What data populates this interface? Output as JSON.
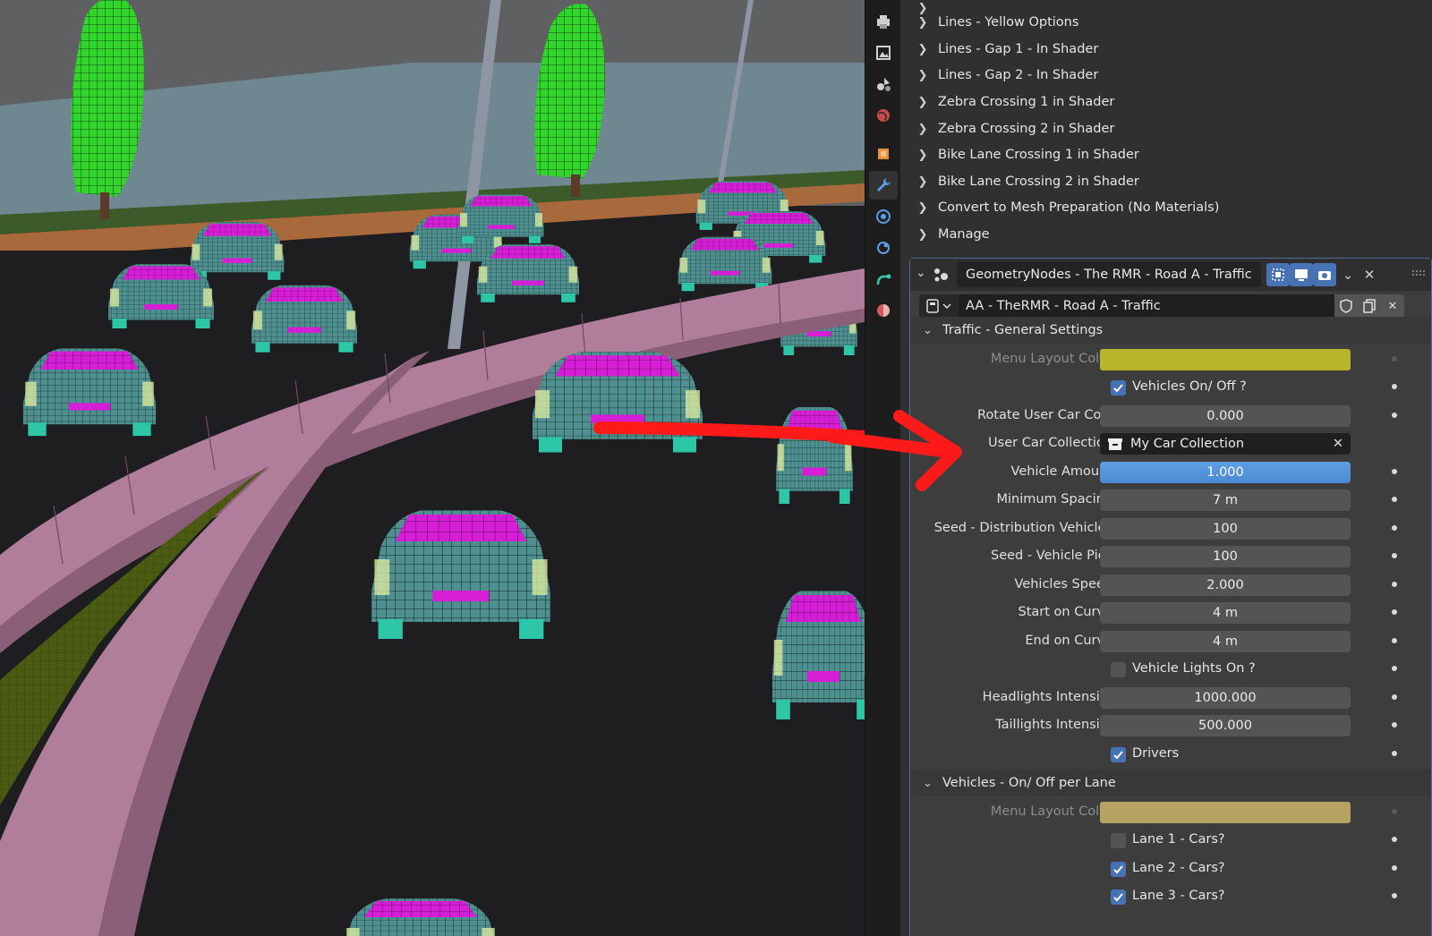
{
  "panel": {
    "collapsed_subpanels": [
      "Lines - Yellow Options",
      "Lines - Gap 1 - In Shader",
      "Lines - Gap 2 - In Shader",
      "Zebra Crossing 1 in Shader",
      "Zebra Crossing 2 in Shader",
      "Bike Lane Crossing 1 in Shader",
      "Bike Lane Crossing 2 in Shader",
      "Convert to Mesh Preparation (No Materials)",
      "Manage"
    ],
    "modifier": {
      "name": "GeometryNodes - The RMR - Road A - Traffic",
      "node_group": "AA - TheRMR - Road A - Traffic"
    },
    "section_general": {
      "title": "Traffic - General Settings",
      "menu_layout_color_label": "Menu Layout Color",
      "menu_layout_color": "#b7b52c",
      "vehicles_on_off_label": "Vehicles On/ Off ?",
      "vehicles_on_off": true,
      "rotate_label": "Rotate User Car Coll.",
      "rotate_value": "0.000",
      "user_car_collection_label": "User Car Collection",
      "user_car_collection_value": "My Car Collection",
      "vehicle_amount_label": "Vehicle Amount",
      "vehicle_amount_value": "1.000",
      "min_spacing_label": "Minimum Spacing",
      "min_spacing_value": "7 m",
      "seed_dist_label": "Seed - Distribution Vehicles",
      "seed_dist_value": "100",
      "seed_pick_label": "Seed - Vehicle Pick",
      "seed_pick_value": "100",
      "speed_label": "Vehicles Speed",
      "speed_value": "2.000",
      "start_label": "Start on Curve",
      "start_value": "4 m",
      "end_label": "End on Curve",
      "end_value": "4 m",
      "lights_label": "Vehicle Lights On ?",
      "lights_on": false,
      "headlights_label": "Headlights Intensity",
      "headlights_value": "1000.000",
      "taillights_label": "Taillights Intensity",
      "taillights_value": "500.000",
      "drivers_label": "Drivers",
      "drivers_on": true
    },
    "section_lanes": {
      "title": "Vehicles - On/ Off per Lane",
      "menu_layout_color_label": "Menu Layout Color",
      "menu_layout_color": "#b6a262",
      "lane1_label": "Lane 1 - Cars?",
      "lane1_on": false,
      "lane2_label": "Lane 2 - Cars?",
      "lane2_on": true,
      "lane3_label": "Lane 3 - Cars?",
      "lane3_on": true
    }
  },
  "colors": {
    "accent": "#4772b3",
    "slider": "#4a90d9",
    "annotation_arrow": "#ff1a1a",
    "car_body": "#4f8f8f",
    "car_glass": "#d61ed6",
    "tree": "#33d42b",
    "barrier": "#b07e9b"
  }
}
